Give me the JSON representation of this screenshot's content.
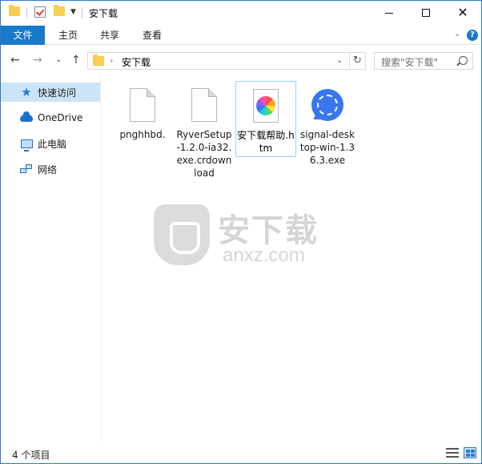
{
  "window": {
    "title": "安下载",
    "controls": {
      "minimize": "minimize",
      "maximize": "maximize",
      "close": "✕"
    }
  },
  "ribbon": {
    "tabs": [
      {
        "label": "文件",
        "active": true
      },
      {
        "label": "主页"
      },
      {
        "label": "共享"
      },
      {
        "label": "查看"
      }
    ],
    "expand_icon": "chevron-down-icon",
    "help_label": "?"
  },
  "address": {
    "path": "安下载",
    "separator": "›",
    "dropdown": "⌄",
    "refresh": "↻"
  },
  "search": {
    "placeholder": "搜索\"安下载\""
  },
  "nav": {
    "items": [
      {
        "label": "快速访问",
        "icon": "star-icon",
        "selected": true
      },
      {
        "label": "OneDrive",
        "icon": "onedrive-cloud-icon"
      },
      {
        "label": "此电脑",
        "icon": "computer-icon"
      },
      {
        "label": "网络",
        "icon": "network-icon"
      }
    ]
  },
  "files": [
    {
      "name": "pnghhbd.",
      "icon": "blank-document-icon"
    },
    {
      "name": "RyverSetup-1.2.0-ia32.exe.crdownload",
      "icon": "blank-document-icon"
    },
    {
      "name": "安下载帮助.htm",
      "icon": "pinwheel-htm-icon",
      "selected": true
    },
    {
      "name": "signal-desktop-win-1.36.3.exe",
      "icon": "signal-app-icon"
    }
  ],
  "watermark": {
    "text_cn": "安下载",
    "text_en": "anxz.com"
  },
  "status": {
    "item_count": "4 个项目"
  },
  "colors": {
    "accent": "#1979ca",
    "selection": "#cce4f7",
    "folder": "#f7cd54",
    "signal": "#3a76f0"
  }
}
